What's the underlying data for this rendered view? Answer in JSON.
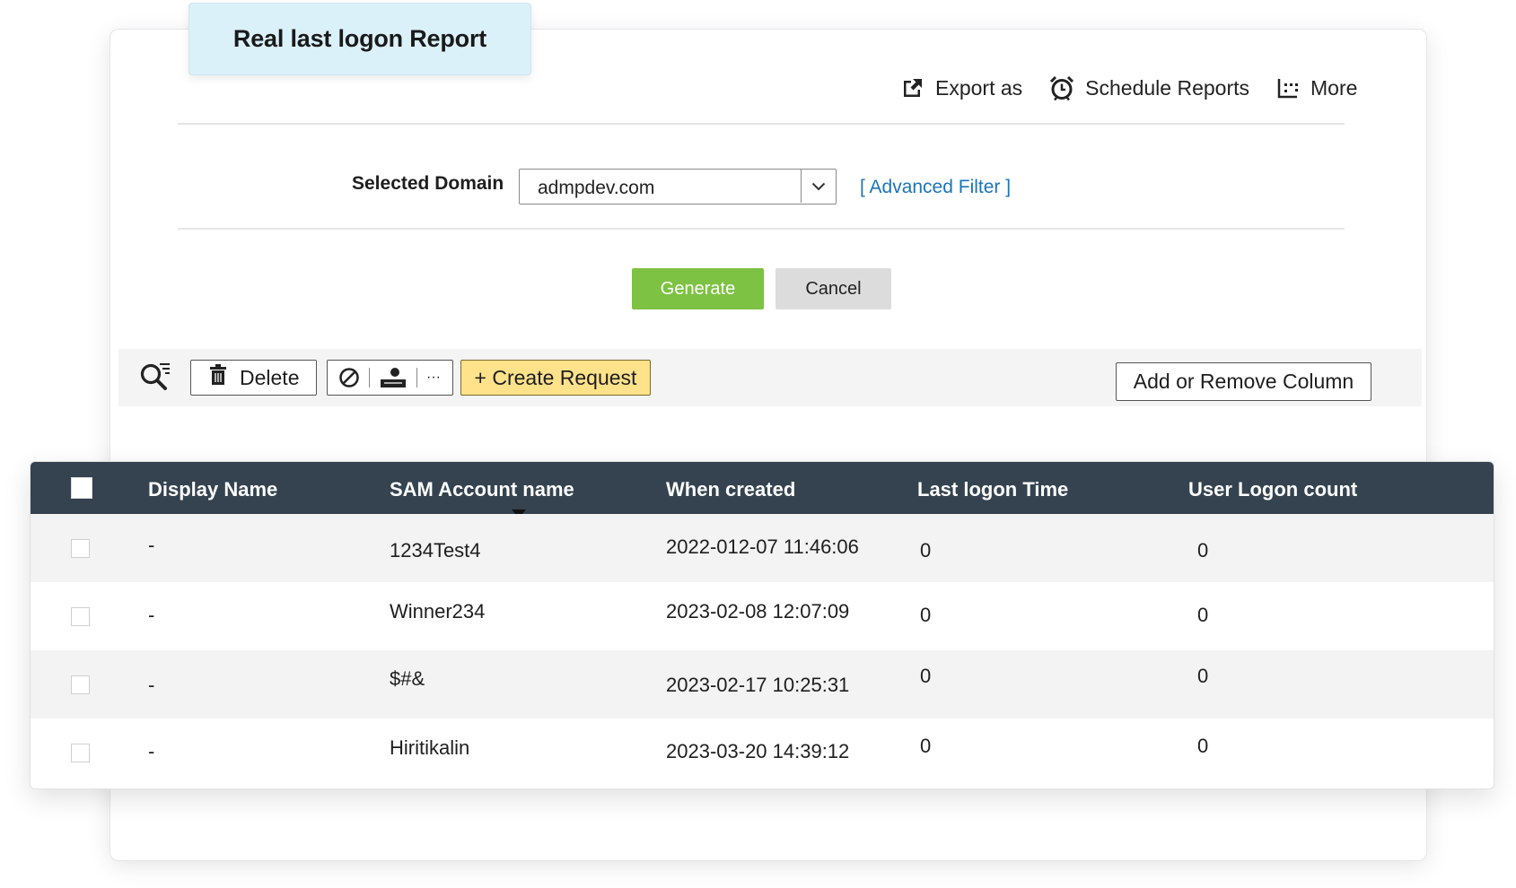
{
  "report": {
    "title": "Real last logon Report"
  },
  "actions": {
    "export_label": "Export as",
    "schedule_label": "Schedule Reports",
    "more_label": "More"
  },
  "filter": {
    "domain_label": "Selected Domain",
    "domain_value": "admpdev.com",
    "advanced_filter": "[ Advanced Filter ]",
    "generate_label": "Generate",
    "cancel_label": "Cancel"
  },
  "toolbar": {
    "delete_label": "Delete",
    "more_dots": "···",
    "create_request_label": "+ Create Request",
    "columns_label": "Add or Remove Column"
  },
  "table": {
    "columns": [
      "Display Name",
      "SAM Account name",
      "When created",
      "Last logon Time",
      "User Logon count"
    ],
    "sorted_column": "SAM Account name",
    "rows": [
      {
        "display_name": "-",
        "sam": "1234Test4",
        "created": "2022-012-07 11:46:06",
        "last_logon": "0",
        "logon_count": "0"
      },
      {
        "display_name": "-",
        "sam": "Winner234",
        "created": "2023-02-08 12:07:09",
        "last_logon": "0",
        "logon_count": "0"
      },
      {
        "display_name": "-",
        "sam": "$#&",
        "created": "2023-02-17 10:25:31",
        "last_logon": "0",
        "logon_count": "0"
      },
      {
        "display_name": "-",
        "sam": "Hiritikalin",
        "created": "2023-03-20 14:39:12",
        "last_logon": "0",
        "logon_count": "0"
      }
    ]
  },
  "colors": {
    "header_bg": "#34434f",
    "generate_bg": "#7dc242",
    "create_request_bg": "#ffe28a",
    "link": "#1a75b8",
    "title_tab_bg": "#dbf1fa"
  }
}
